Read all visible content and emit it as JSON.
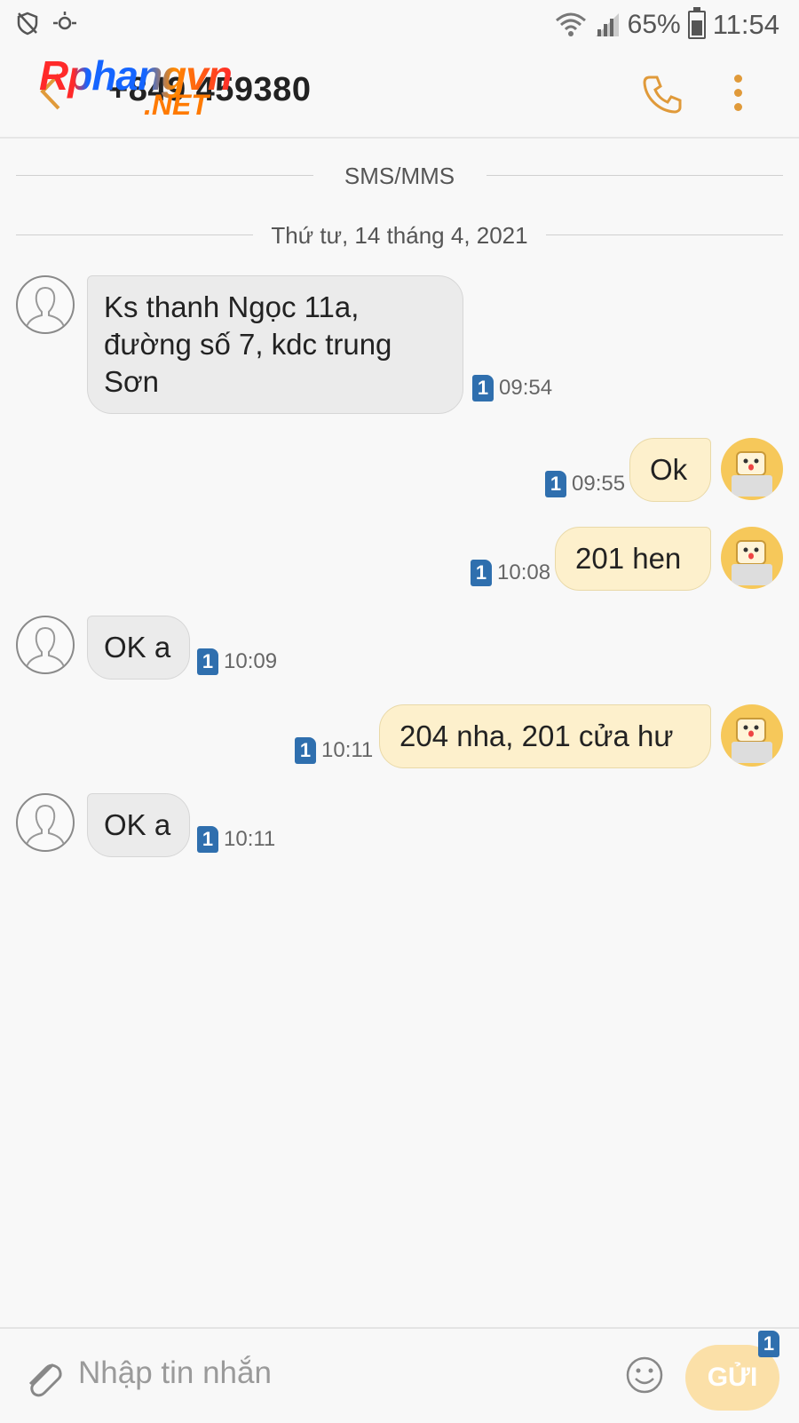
{
  "status_bar": {
    "battery_percent": "65%",
    "time": "11:54",
    "icons": [
      "shield-off-icon",
      "eye-comfort-icon",
      "wifi-icon",
      "signal-icon",
      "battery-icon"
    ]
  },
  "header": {
    "back_icon": "chevron-left-icon",
    "contact": "+849 459380",
    "call_icon": "phone-icon",
    "menu_icon": "more-vertical-icon"
  },
  "watermark": {
    "line1": "Rphangvn",
    "line2": ".NET"
  },
  "conversation": {
    "type_label": "SMS/MMS",
    "date_label": "Thứ tư, 14 tháng 4, 2021"
  },
  "messages": [
    {
      "direction": "in",
      "text": "Ks thanh Ngọc 11a, đường số 7, kdc trung Sơn",
      "sim": "1",
      "time": "09:54"
    },
    {
      "direction": "out",
      "text": "Ok",
      "sim": "1",
      "time": "09:55"
    },
    {
      "direction": "out",
      "text": "201 hen",
      "sim": "1",
      "time": "10:08"
    },
    {
      "direction": "in",
      "text": "OK a",
      "sim": "1",
      "time": "10:09"
    },
    {
      "direction": "out",
      "text": "204 nha, 201 cửa hư",
      "sim": "1",
      "time": "10:11"
    },
    {
      "direction": "in",
      "text": "OK a",
      "sim": "1",
      "time": "10:11"
    }
  ],
  "composer": {
    "placeholder": "Nhập tin nhắn",
    "send_label": "GỬI",
    "send_sim": "1",
    "attach_icon": "paperclip-icon",
    "emoji_icon": "smiley-icon"
  },
  "colors": {
    "accent": "#e09a3a",
    "incoming_bubble": "#ebebeb",
    "outgoing_bubble": "#fdf0cc",
    "sim_badge": "#2f6fae"
  }
}
